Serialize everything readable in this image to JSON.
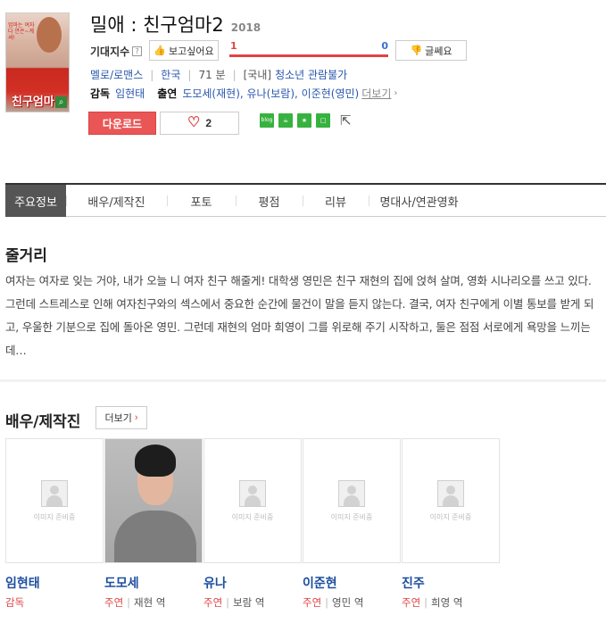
{
  "movie": {
    "title": "밀애 : 친구엄마2",
    "year": "2018",
    "poster_blurb": "엄마는 여자다 연은~계셔!",
    "poster_title": "친구엄마"
  },
  "expectation": {
    "label": "기대지수",
    "help": "?",
    "like_label": "보고싶어요",
    "like_count": "1",
    "dislike_count": "0",
    "like_ratio": 1.0,
    "dislike_label": "글쎄요"
  },
  "meta": {
    "genre": "멜로/로맨스",
    "country": "한국",
    "runtime": "71 분",
    "rating_prefix": "[국내]",
    "rating": "청소년 관람불가"
  },
  "credits": {
    "director_label": "감독",
    "director": "임현태",
    "cast_label": "출연",
    "cast_list": "도모세(재현), 유나(보람), 이준현(영민)",
    "more": "더보기"
  },
  "actions": {
    "download": "다운로드",
    "heart_count": "2",
    "share_icons": [
      "blog",
      "cafe",
      "star",
      "square"
    ]
  },
  "tabs": [
    "주요정보",
    "배우/제작진",
    "포토",
    "평점",
    "리뷰",
    "명대사/연관영화"
  ],
  "synopsis": {
    "title": "줄거리",
    "text": "여자는 여자로 잊는 거야, 내가 오늘 니 여자 친구 해줄게! 대학생 영민은 친구 재현의 집에 얹혀 살며, 영화 시나리오를 쓰고 있다. 그런데 스트레스로 인해 여자친구와의 섹스에서 중요한 순간에 물건이 말을 듣지 않는다. 결국, 여자 친구에게 이별 통보를 받게 되고, 우울한 기분으로 집에 돌아온 영민. 그런데 재현의 엄마 희영이 그를 위로해 주기 시작하고, 둘은 점점 서로에게 욕망을 느끼는데…"
  },
  "cast_section": {
    "title": "배우/제작진",
    "more": "더보기",
    "no_image": "이미지 준비중",
    "people": [
      {
        "name": "임현태",
        "role": "감독",
        "character": "",
        "has_photo": false
      },
      {
        "name": "도모세",
        "role": "주연",
        "character": "재현 역",
        "has_photo": true
      },
      {
        "name": "유나",
        "role": "주연",
        "character": "보람 역",
        "has_photo": false
      },
      {
        "name": "이준현",
        "role": "주연",
        "character": "영민 역",
        "has_photo": false
      },
      {
        "name": "진주",
        "role": "주연",
        "character": "희영 역",
        "has_photo": false
      }
    ]
  }
}
